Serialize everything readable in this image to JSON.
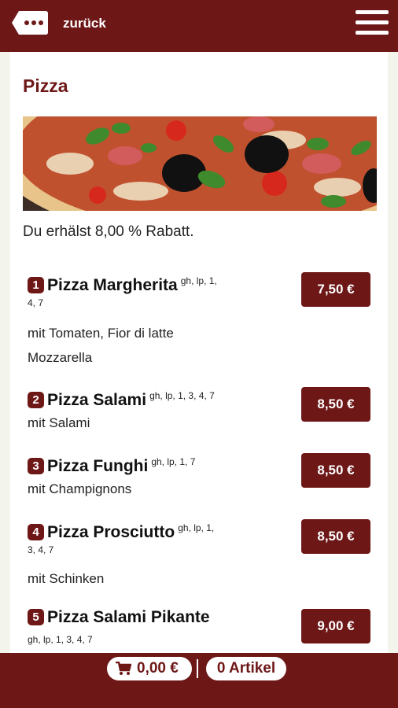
{
  "header": {
    "back_label": "zurück",
    "back_icon": "chat-bubble-dots-icon",
    "menu_icon": "hamburger-menu-icon"
  },
  "category": {
    "title": "Pizza",
    "hero_image": "pizza-photo",
    "discount_text": "Du erhälst 8,00 % Rabatt."
  },
  "items": [
    {
      "number": "1",
      "name": "Pizza Margherita",
      "allergens_a": "gh, lp, 1,",
      "allergens_b": "4, 7",
      "desc_1": "mit Tomaten, Fior di latte",
      "desc_2": "Mozzarella",
      "price": "7,50 €"
    },
    {
      "number": "2",
      "name": "Pizza Salami",
      "allergens": "gh, lp, 1, 3, 4, 7",
      "desc": "mit Salami",
      "price": "8,50 €"
    },
    {
      "number": "3",
      "name": "Pizza Funghi",
      "allergens": "gh, lp, 1, 7",
      "desc": "mit Champignons",
      "price": "8,50 €"
    },
    {
      "number": "4",
      "name": "Pizza Prosciutto",
      "allergens_a": "gh, lp, 1,",
      "allergens_b": "3, 4, 7",
      "desc": "mit Schinken",
      "price": "8,50 €"
    },
    {
      "number": "5",
      "name": "Pizza Salami Pikante",
      "allergens": "gh, lp, 1, 3, 4, 7",
      "price": "9,00 €"
    }
  ],
  "footer": {
    "cart_total": "0,00 €",
    "cart_icon": "shopping-cart-icon",
    "article_count": "0 Artikel"
  },
  "colors": {
    "brand": "#6e1717",
    "background": "#f3f4ec"
  }
}
